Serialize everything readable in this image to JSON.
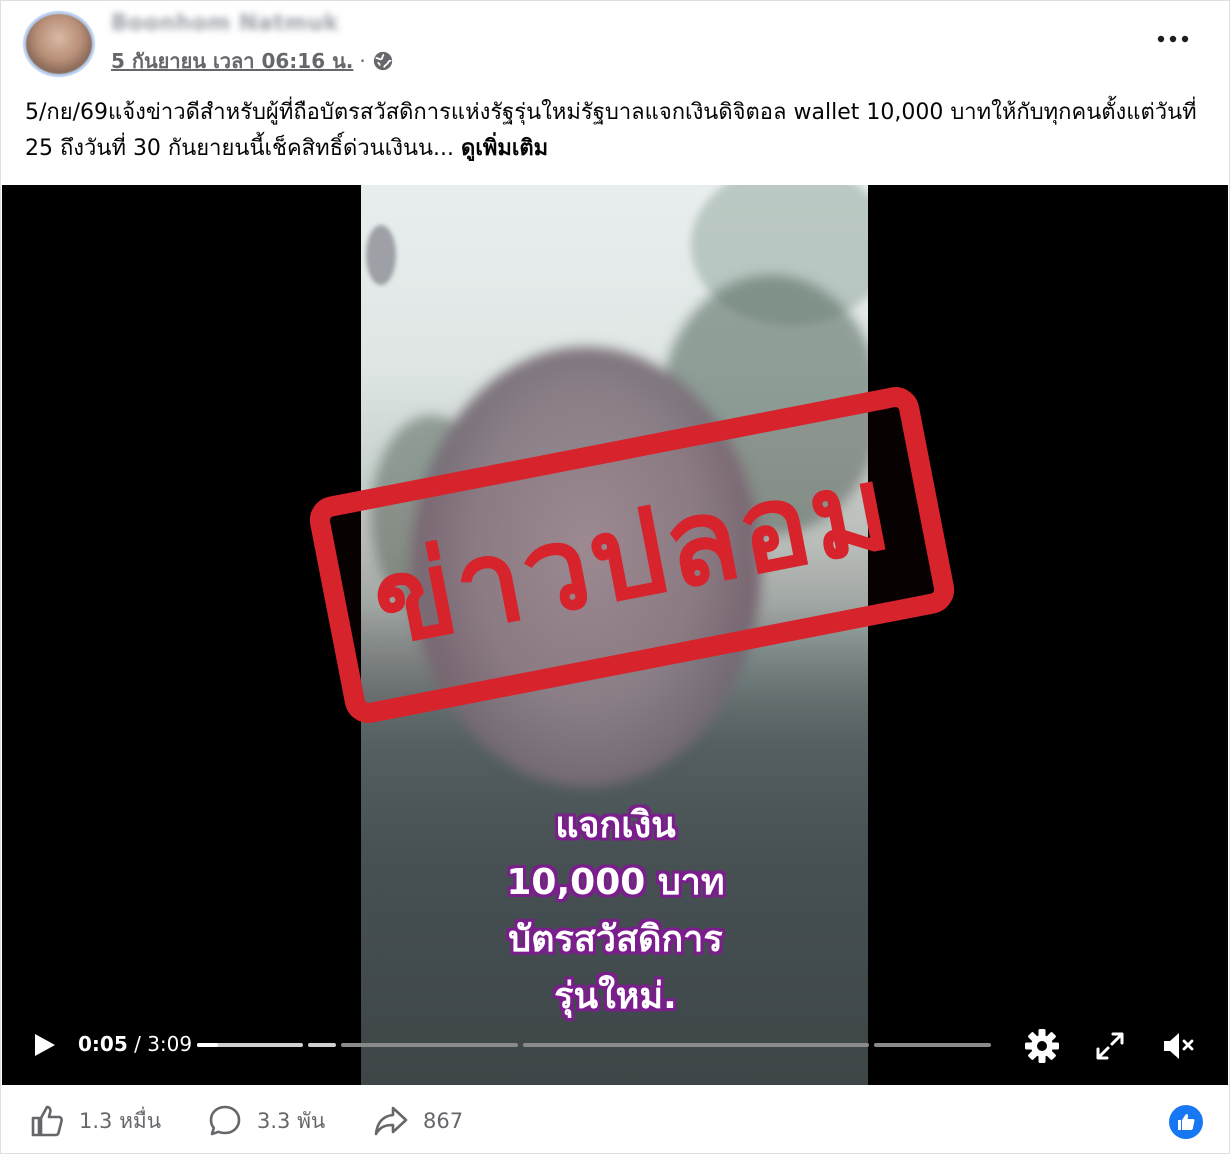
{
  "post": {
    "author": "Boonhom Natmuk",
    "timestamp": "5 กันยายน เวลา 06:16 น.",
    "separator": "·",
    "more_icon": "more-horizontal-icon",
    "privacy_icon": "globe-icon",
    "text": "5/กย/69แจ้งข่าวดีสำหรับผู้ที่ถือบัตรสวัสดิการแห่งรัฐรุ่นใหม่รัฐบาลแจกเงินดิจิตอล wallet 10,000 บาทให้กับทุกคนตั้งแต่วันที่ 25 ถึงวันที่ 30 กันยายนนี้เช็คสิทธิ์ด่วนเงินน...",
    "see_more": "ดูเพิ่มเติม"
  },
  "video": {
    "stamp_text": "ข่าวปลอม",
    "overlay_lines": [
      "แจกเงิน",
      "10,000 บาท",
      "บัตรสวัสดิการ",
      "รุ่นใหม่."
    ],
    "current_time": "0:05",
    "time_separator": " / ",
    "duration": "3:09",
    "progress_fraction": 0.026,
    "stamp_color": "#d7232b",
    "caption_outline_color": "#7a1e8c"
  },
  "reactions": {
    "likes": "1.3 หมื่น",
    "comments": "3.3 พัน",
    "shares": "867",
    "accent": "#1877f2"
  }
}
